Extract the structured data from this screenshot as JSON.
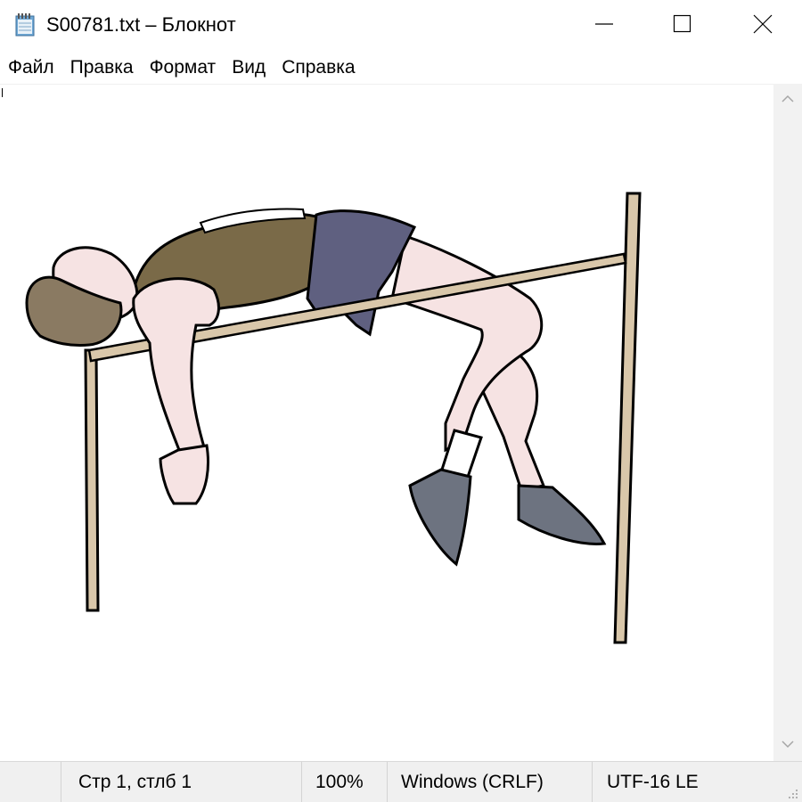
{
  "window": {
    "title": "S00781.txt – Блокнот",
    "app_icon": "notepad-icon",
    "controls": [
      "minimize-icon",
      "maximize-icon",
      "close-icon"
    ]
  },
  "menu": {
    "items": [
      "Файл",
      "Правка",
      "Формат",
      "Вид",
      "Справка"
    ]
  },
  "editor": {
    "content_description_hidden": "",
    "picture_icon": "high-jump-athlete-illustration"
  },
  "status": {
    "position": "Стр 1, стлб 1",
    "zoom": "100%",
    "line_endings": "Windows (CRLF)",
    "encoding": "UTF-16 LE"
  },
  "colors": {
    "shirt": "#7a6a48",
    "shorts": "#5f6080",
    "skin": "#f6e3e3",
    "hair": "#8a7a62",
    "posts": "#d9c7aa",
    "shoes": "#6d7380"
  }
}
